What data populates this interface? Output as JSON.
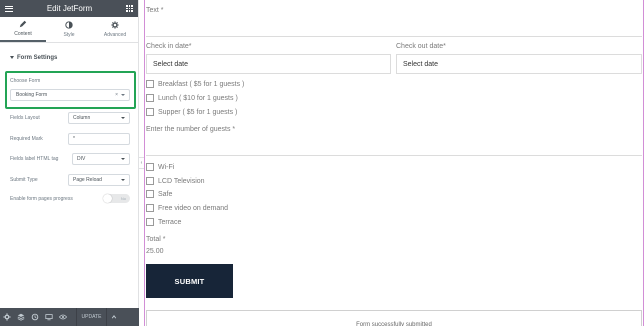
{
  "panel": {
    "title": "Edit JetForm",
    "tabs": [
      {
        "label": "Content",
        "icon": "pencil-icon"
      },
      {
        "label": "Style",
        "icon": "half-circle-icon"
      },
      {
        "label": "Advanced",
        "icon": "gear-icon"
      }
    ],
    "section_title": "Form Settings",
    "choose_form": {
      "label": "Choose Form",
      "value": "Booking Form",
      "clear": "×"
    },
    "fields_layout": {
      "label": "Fields Layout",
      "value": "Column"
    },
    "required_mark": {
      "label": "Required Mark",
      "value": "*"
    },
    "fields_label_tag": {
      "label": "Fields label HTML tag",
      "value": "DIV"
    },
    "submit_type": {
      "label": "Submit Type",
      "value": "Page Reload"
    },
    "enable_progress": {
      "label": "Enable form pages progress",
      "toggle_text": "No"
    },
    "footer": {
      "update_label": "UPDATE"
    },
    "collapse_glyph": "‹"
  },
  "form": {
    "text_label": "Text *",
    "check_in_label": "Check in date*",
    "check_in_value": "Select date",
    "check_out_label": "Check out date*",
    "check_out_value": "Select date",
    "meals": [
      "Breakfast ( $5 for 1 guests )",
      "Lunch ( $10 for 1 guests )",
      "Supper ( $5 for 1 guests )"
    ],
    "guests_label": "Enter the number of guests *",
    "amenities": [
      "Wi-Fi",
      "LCD Television",
      "Safe",
      "Free video on demand",
      "Terrace"
    ],
    "total_label": "Total *",
    "total_value": "25.00",
    "submit_label": "SUBMIT",
    "success_message": "Form successfully submitted"
  },
  "colors": {
    "panel_header": "#4a5058",
    "highlight_border": "#23a455",
    "submit_bg": "#172538",
    "preview_outline": "#d28ed6"
  }
}
